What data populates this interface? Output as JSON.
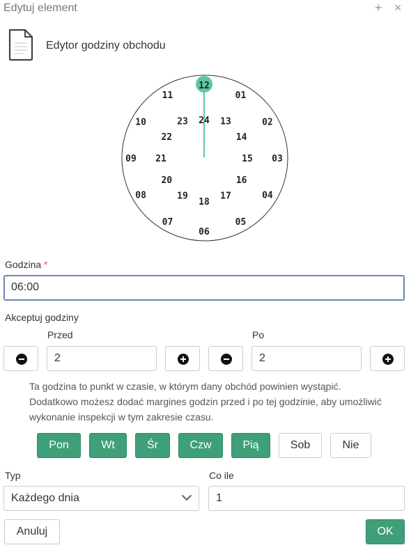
{
  "window": {
    "title": "Edytuj element",
    "plus_icon": "plus-icon",
    "close_icon": "close-icon"
  },
  "header": {
    "title": "Edytor godziny obchodu",
    "icon": "document-icon"
  },
  "clock": {
    "selected": "12",
    "outer": [
      "12",
      "01",
      "02",
      "03",
      "04",
      "05",
      "06",
      "07",
      "08",
      "09",
      "10",
      "11"
    ],
    "inner": [
      "24",
      "13",
      "14",
      "15",
      "16",
      "17",
      "18",
      "19",
      "20",
      "21",
      "22",
      "23"
    ],
    "accent": "#5dc7a0"
  },
  "hour": {
    "label": "Godzina",
    "required_mark": "*",
    "value": "06:00"
  },
  "accept": {
    "label": "Akceptuj godziny",
    "before": {
      "label": "Przed",
      "value": "2"
    },
    "after": {
      "label": "Po",
      "value": "2"
    }
  },
  "help": {
    "line1": "Ta godzina to punkt w czasie, w którym dany obchód powinien wystąpić.",
    "line2": "Dodatkowo możesz dodać margines godzin przed i po tej godzinie, aby umożliwić",
    "line3": "wykonanie inspekcji w tym zakresie czasu."
  },
  "days": [
    {
      "label": "Pon",
      "active": true
    },
    {
      "label": "Wt",
      "active": true
    },
    {
      "label": "Śr",
      "active": true
    },
    {
      "label": "Czw",
      "active": true
    },
    {
      "label": "Pią",
      "active": true
    },
    {
      "label": "Sob",
      "active": false
    },
    {
      "label": "Nie",
      "active": false
    }
  ],
  "type": {
    "label": "Typ",
    "value": "Każdego dnia"
  },
  "every": {
    "label": "Co ile",
    "value": "1"
  },
  "buttons": {
    "cancel": "Anuluj",
    "ok": "OK"
  },
  "colors": {
    "accent": "#3f9f78",
    "focus_border": "#6d86b6",
    "required": "#d9534f"
  }
}
